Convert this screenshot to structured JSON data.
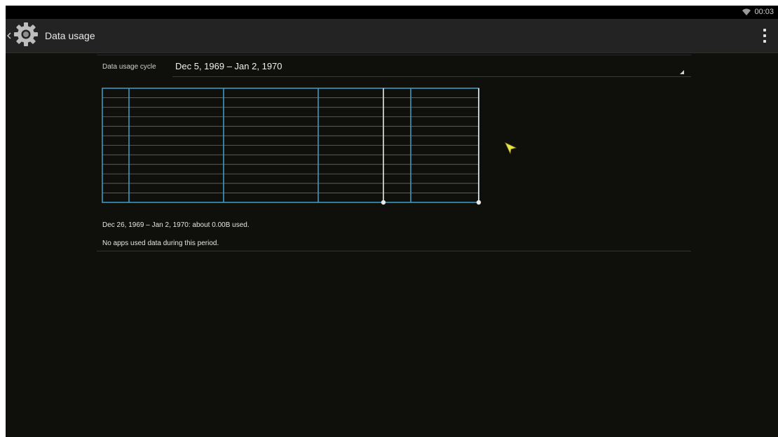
{
  "status_bar": {
    "time": "00:03",
    "icons": [
      "wifi-icon"
    ]
  },
  "action_bar": {
    "title": "Data usage",
    "icons": [
      "back-chevron-icon",
      "settings-gear-icon",
      "overflow-menu-icon"
    ]
  },
  "cycle": {
    "label": "Data usage cycle",
    "value": "Dec 5, 1969 – Jan 2, 1970"
  },
  "chart_data": {
    "type": "line",
    "title": "",
    "xlabel": "",
    "ylabel": "",
    "grid": true,
    "series": [],
    "range_handles": [
      "start",
      "end"
    ],
    "colors": {
      "grid": "#3f98c0",
      "handle": "#e8e8e8",
      "data": "#7a7a7a"
    }
  },
  "summary": {
    "range_text": "Dec 26, 1969 – Jan 2, 1970: about 0.00B used.",
    "apps_text": "No apps used data during this period."
  },
  "colors": {
    "background": "#0f0f0b",
    "action_bar": "#232323",
    "accent": "#3f98c0",
    "pointer": "#e6e64a"
  }
}
